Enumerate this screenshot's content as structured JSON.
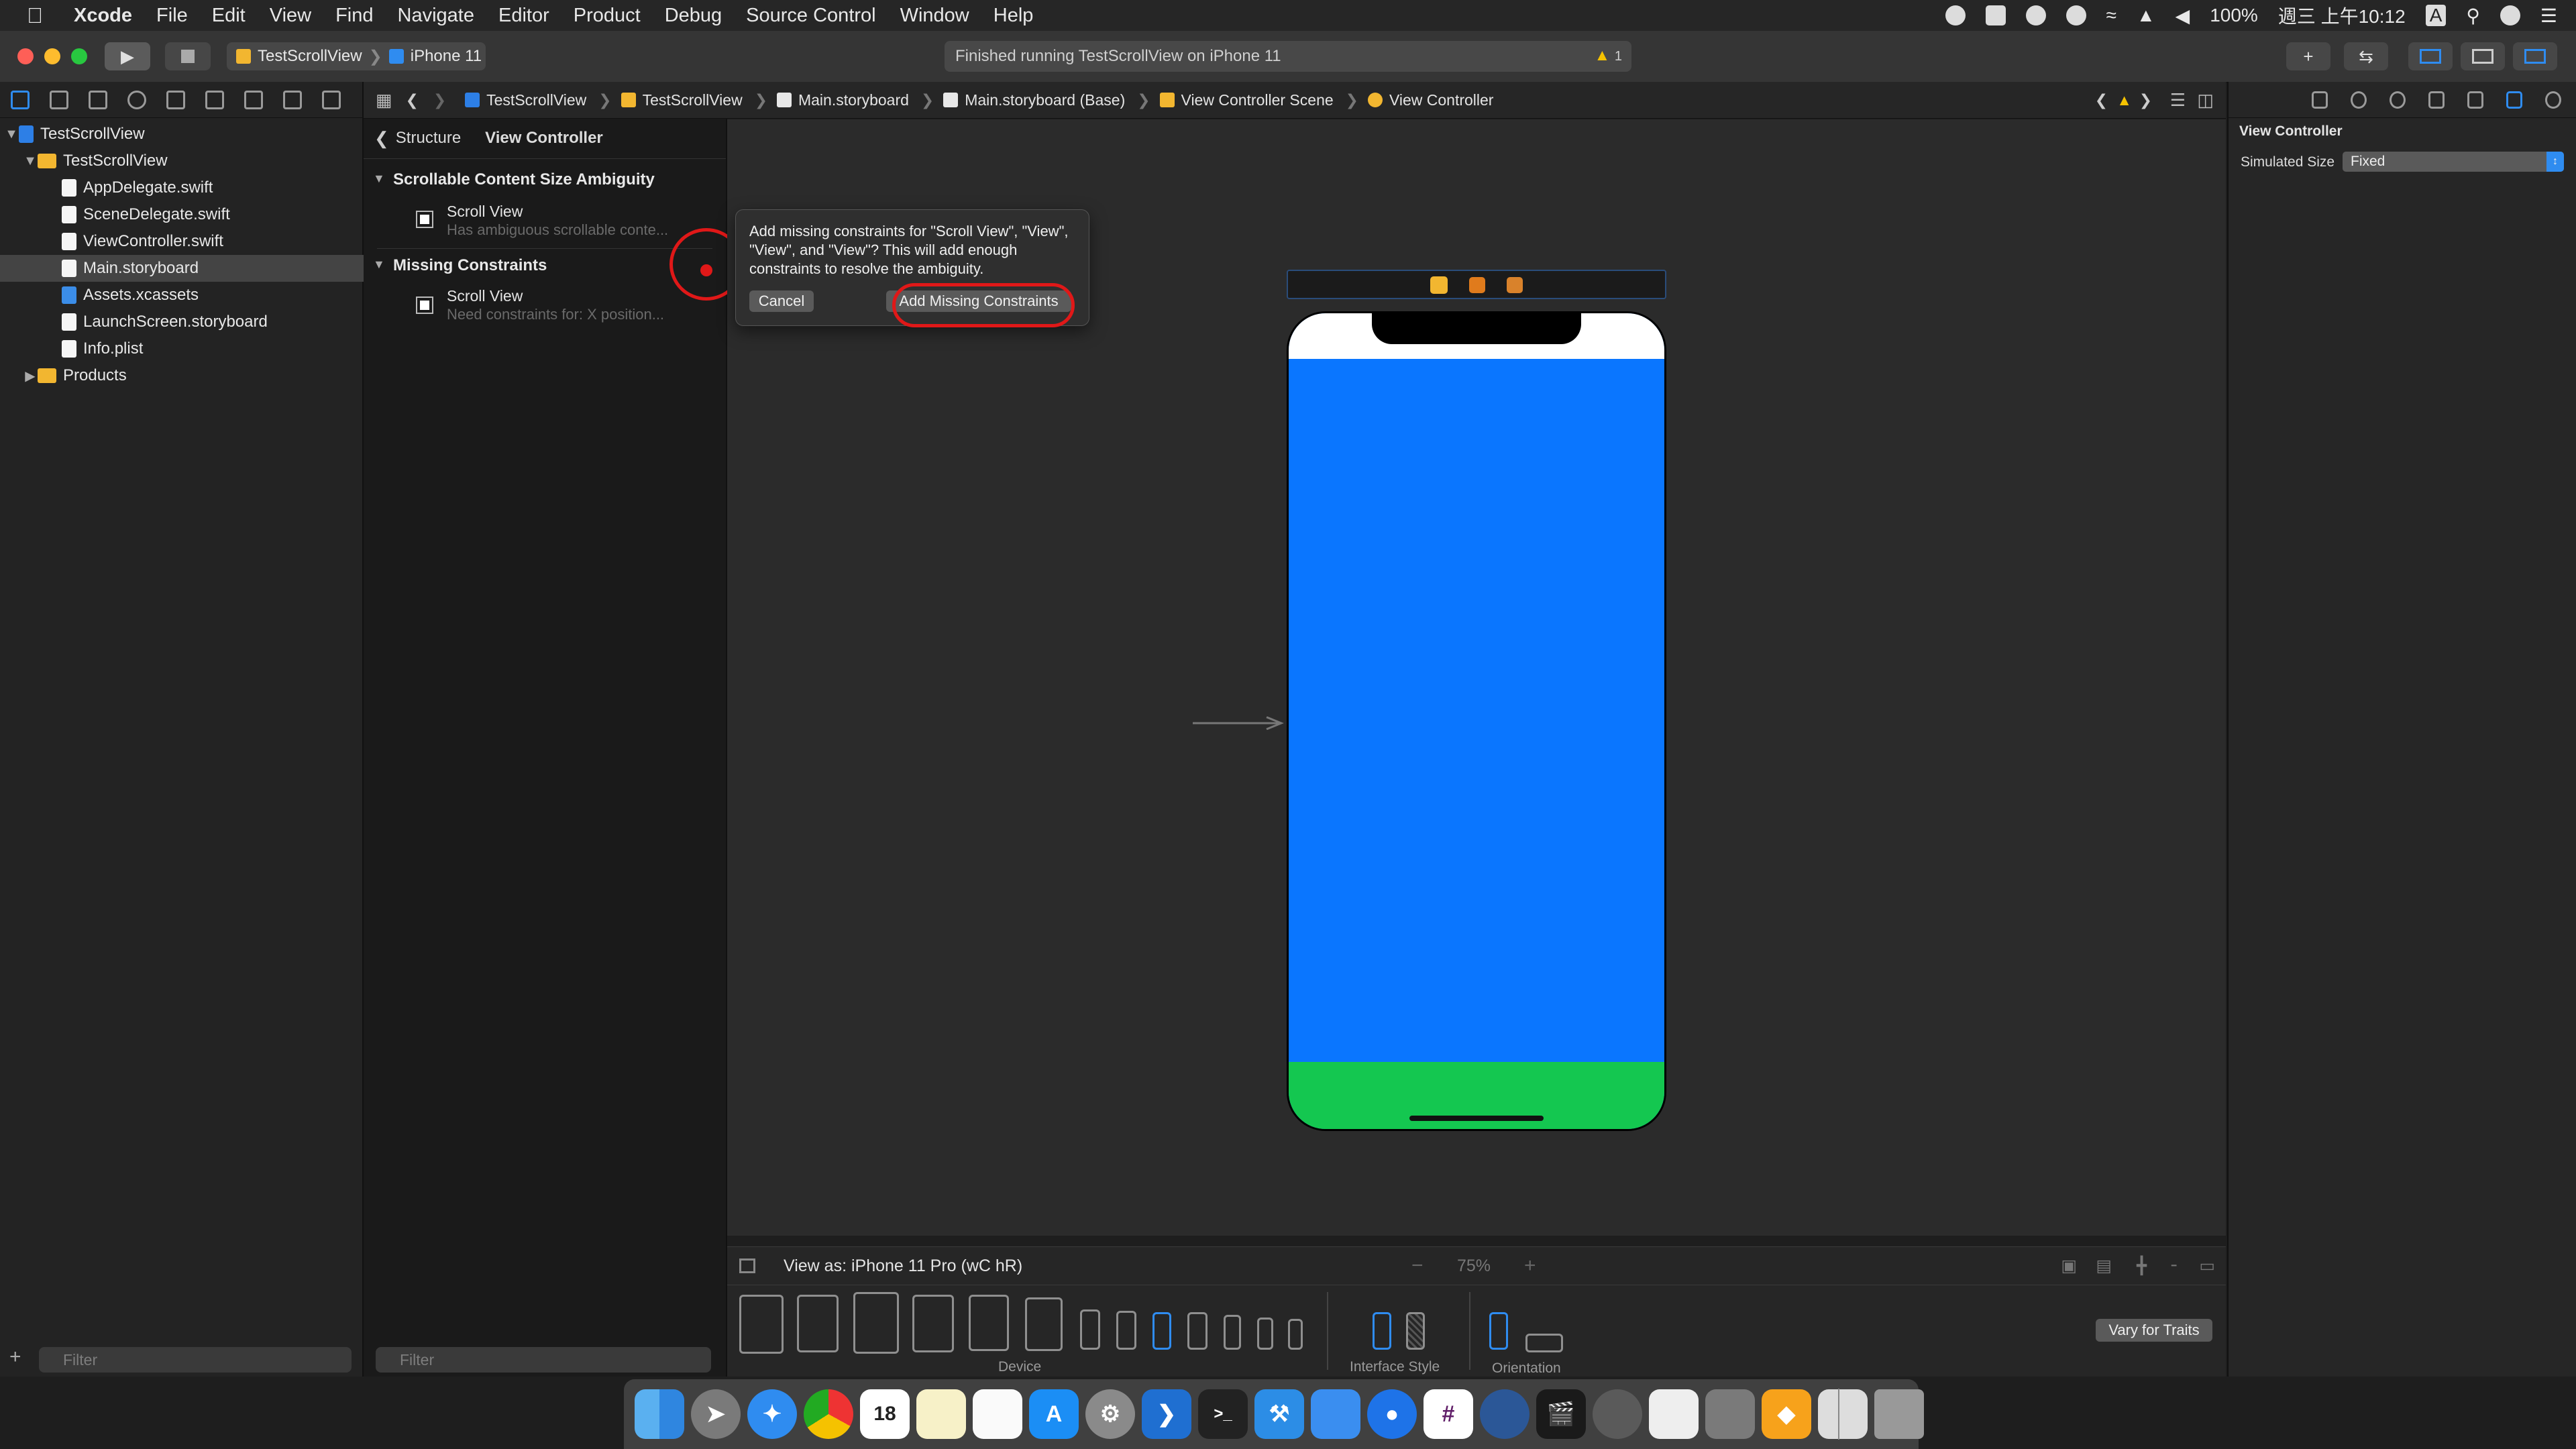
{
  "menubar": {
    "app": "Xcode",
    "items": [
      "File",
      "Edit",
      "View",
      "Find",
      "Navigate",
      "Editor",
      "Product",
      "Debug",
      "Source Control",
      "Window",
      "Help"
    ],
    "battery": "100%",
    "clock": "週三 上午10:12",
    "input_source": "A"
  },
  "toolbar": {
    "scheme": "TestScrollView",
    "destination": "iPhone 11",
    "activity": "Finished running TestScrollView on iPhone 11",
    "warning_count": "1"
  },
  "navigator": {
    "items": [
      {
        "label": "TestScrollView",
        "kind": "project"
      },
      {
        "label": "TestScrollView",
        "kind": "folder"
      },
      {
        "label": "AppDelegate.swift",
        "kind": "swift"
      },
      {
        "label": "SceneDelegate.swift",
        "kind": "swift"
      },
      {
        "label": "ViewController.swift",
        "kind": "swift"
      },
      {
        "label": "Main.storyboard",
        "kind": "storyboard",
        "selected": true
      },
      {
        "label": "Assets.xcassets",
        "kind": "assets"
      },
      {
        "label": "LaunchScreen.storyboard",
        "kind": "storyboard"
      },
      {
        "label": "Info.plist",
        "kind": "plist"
      },
      {
        "label": "Products",
        "kind": "folder"
      }
    ],
    "filter_placeholder": "Filter"
  },
  "outline": {
    "back_label": "Structure",
    "title": "View Controller",
    "sections": [
      {
        "title": "Scrollable Content Size Ambiguity",
        "item": "Scroll View",
        "detail": "Has ambiguous scrollable conte..."
      },
      {
        "title": "Missing Constraints",
        "item": "Scroll View",
        "detail": "Need constraints for: X position..."
      }
    ],
    "filter_placeholder": "Filter"
  },
  "jumpbar": {
    "crumbs": [
      "TestScrollView",
      "TestScrollView",
      "Main.storyboard",
      "Main.storyboard (Base)",
      "View Controller Scene",
      "View Controller"
    ]
  },
  "popover": {
    "message": "Add missing constraints for \"Scroll View\", \"View\", \"View\", and \"View\"? This will add enough constraints to resolve the ambiguity.",
    "cancel": "Cancel",
    "confirm": "Add Missing Constraints"
  },
  "canvas": {
    "view_as": "View as: iPhone 11 Pro (wC hR)",
    "zoom": "75%",
    "device_label": "Device",
    "interface_style_label": "Interface Style",
    "orientation_label": "Orientation",
    "vary_for_traits": "Vary for Traits"
  },
  "inspector": {
    "title": "View Controller",
    "simulated_size_label": "Simulated Size",
    "simulated_size_value": "Fixed"
  },
  "dock": {
    "calendar_day": "18"
  },
  "colors": {
    "accent": "#2f8cf0",
    "phone_blue": "#0a76ff",
    "phone_green": "#14c750",
    "highlight_red": "#e01818"
  }
}
